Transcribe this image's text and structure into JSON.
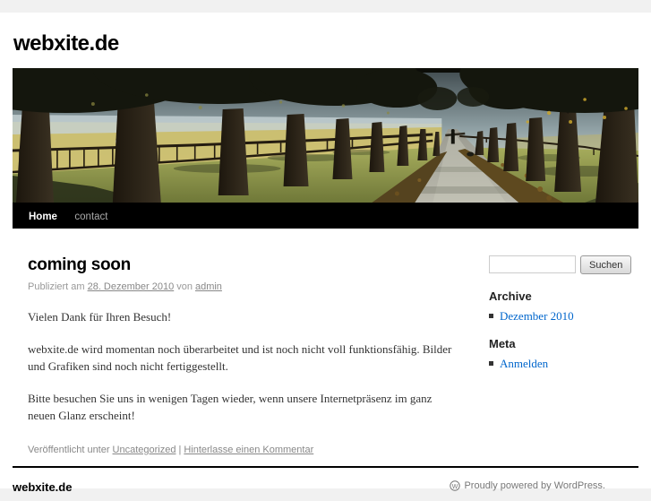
{
  "header": {
    "site_title": "webxite.de",
    "image_description": "Tree-lined avenue with fenced fields, two sheep, leaf-strewn path and a distant walking figure"
  },
  "nav": {
    "items": [
      {
        "label": "Home",
        "active": true
      },
      {
        "label": "contact",
        "active": false
      }
    ]
  },
  "post": {
    "title": "coming soon",
    "meta": {
      "prefix": "Publiziert am",
      "date": "28. Dezember 2010",
      "connector": "von",
      "author": "admin"
    },
    "paragraphs": [
      [
        "Vielen Dank für Ihren Besuch!"
      ],
      [
        "webxite.de  wird momentan noch überarbeitet und ist noch nicht voll funktionsfähig. Bilder",
        "und Grafiken sind noch nicht fertiggestellt."
      ],
      [
        "Bitte besuchen Sie uns in wenigen Tagen wieder, wenn unsere Internetpräsenz im ganz",
        "neuen Glanz erscheint!"
      ]
    ],
    "footer_meta": {
      "prefix": "Veröffentlicht unter",
      "category": "Uncategorized",
      "separator": "|",
      "comment_link": "Hinterlasse einen Kommentar"
    }
  },
  "sidebar": {
    "search": {
      "value": "",
      "placeholder": "",
      "button_label": "Suchen"
    },
    "sections": [
      {
        "title": "Archive",
        "links": [
          "Dezember 2010"
        ]
      },
      {
        "title": "Meta",
        "links": [
          "Anmelden"
        ]
      }
    ]
  },
  "footer": {
    "site_title": "webxite.de",
    "credit_text": "Proudly powered by WordPress.",
    "wp_letter": "W"
  },
  "colors": {
    "page_background": "#f1f1f1",
    "surface": "#ffffff",
    "nav_background": "#000000",
    "nav_active": "#ffffff",
    "nav_inactive": "#aaaaaa",
    "body_text": "#333333",
    "meta_text": "#888888",
    "sidebar_link": "#0066cc",
    "footer_rule": "#000000"
  }
}
